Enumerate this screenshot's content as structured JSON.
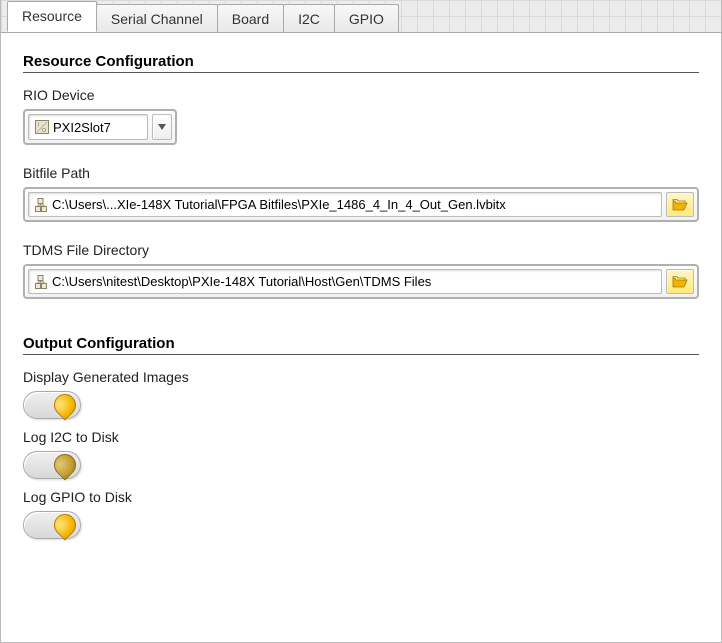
{
  "tabs": {
    "items": [
      {
        "label": "Resource",
        "active": true
      },
      {
        "label": "Serial Channel",
        "active": false
      },
      {
        "label": "Board",
        "active": false
      },
      {
        "label": "I2C",
        "active": false
      },
      {
        "label": "GPIO",
        "active": false
      }
    ]
  },
  "resource": {
    "section_title": "Resource Configuration",
    "rio_label": "RIO Device",
    "rio_value": "PXI2Slot7",
    "bitfile_label": "Bitfile Path",
    "bitfile_value": "C:\\Users\\...XIe-148X Tutorial\\FPGA Bitfiles\\PXIe_1486_4_In_4_Out_Gen.lvbitx",
    "tdms_label": "TDMS File Directory",
    "tdms_value": "C:\\Users\\nitest\\Desktop\\PXIe-148X Tutorial\\Host\\Gen\\TDMS Files"
  },
  "output": {
    "section_title": "Output Configuration",
    "display_label": "Display Generated Images",
    "display_value": true,
    "log_i2c_label": "Log I2C to Disk",
    "log_i2c_value": true,
    "log_gpio_label": "Log GPIO to Disk",
    "log_gpio_value": true
  }
}
